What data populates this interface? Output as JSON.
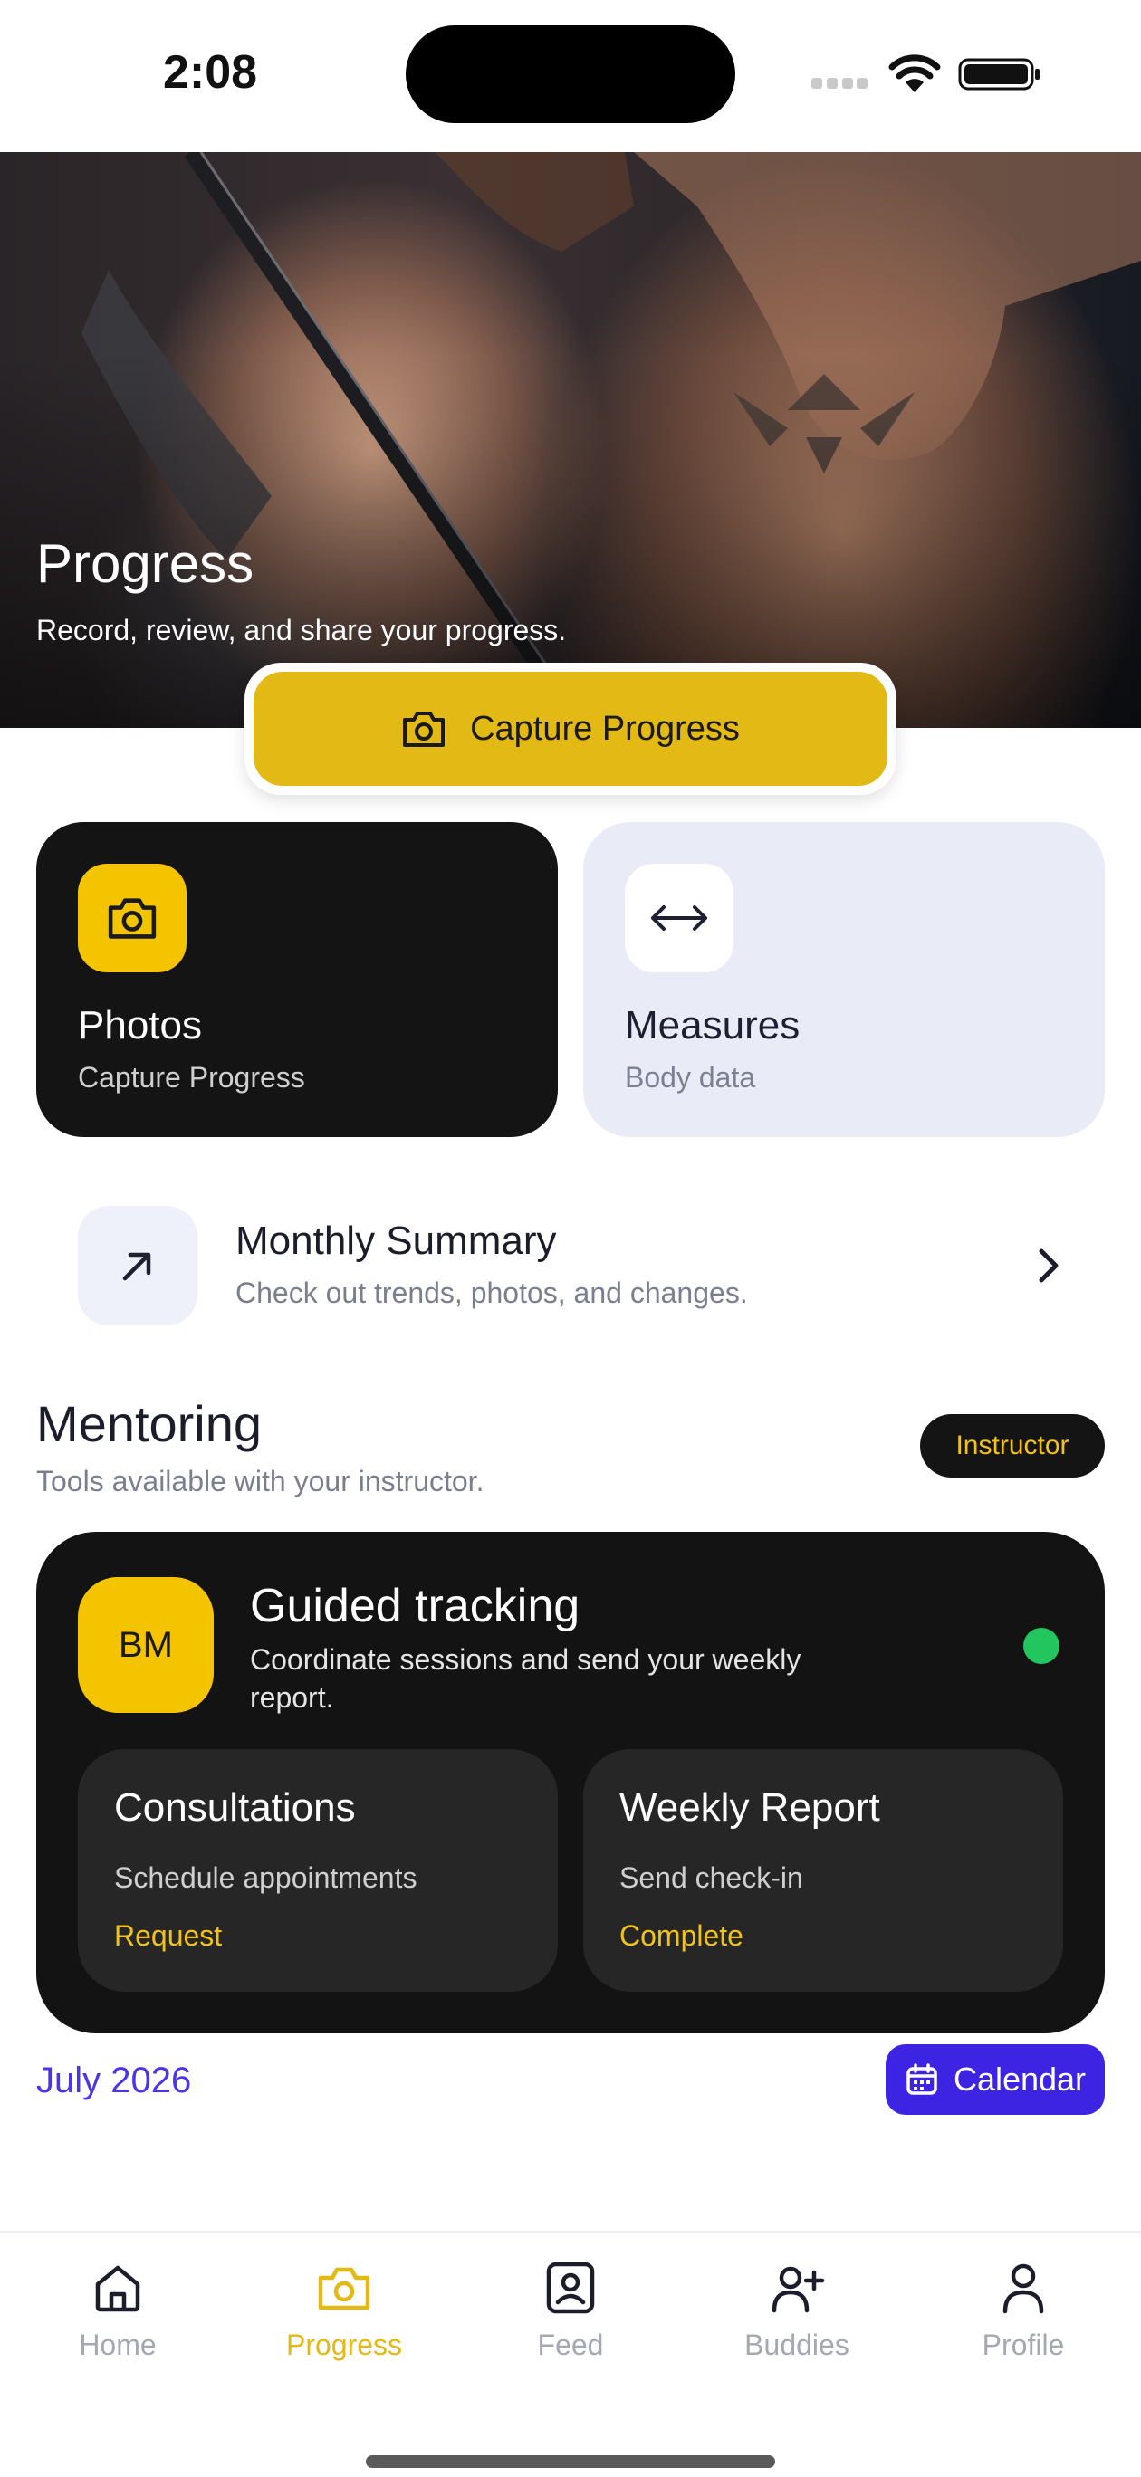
{
  "status_bar": {
    "time": "2:08"
  },
  "hero": {
    "title": "Progress",
    "subtitle": "Record, review, and share your progress.",
    "capture_button": {
      "label": "Capture Progress",
      "icon": "camera-icon"
    }
  },
  "cards": {
    "photos": {
      "title": "Photos",
      "subtitle": "Capture Progress",
      "icon": "camera-icon"
    },
    "measures": {
      "title": "Measures",
      "subtitle": "Body data",
      "icon": "arrows-horizontal-icon"
    }
  },
  "summary": {
    "title": "Monthly Summary",
    "subtitle": "Check out trends, photos, and changes.",
    "icon": "arrow-up-right-icon"
  },
  "mentoring": {
    "title": "Mentoring",
    "subtitle": "Tools available with your instructor.",
    "badge": "Instructor",
    "card": {
      "avatar_initials": "BM",
      "title": "Guided tracking",
      "subtitle": "Coordinate sessions and send your weekly report.",
      "status_color": "#22c55e",
      "consultations": {
        "title": "Consultations",
        "subtitle": "Schedule appointments",
        "action": "Request"
      },
      "weekly_report": {
        "title": "Weekly Report",
        "subtitle": "Send check-in",
        "action": "Complete"
      }
    }
  },
  "calendar": {
    "month": "July 2026",
    "button_label": "Calendar"
  },
  "tabs": [
    {
      "label": "Home",
      "icon": "home-icon",
      "active": false
    },
    {
      "label": "Progress",
      "icon": "camera-icon",
      "active": true
    },
    {
      "label": "Feed",
      "icon": "portrait-icon",
      "active": false
    },
    {
      "label": "Buddies",
      "icon": "add-user-icon",
      "active": false
    },
    {
      "label": "Profile",
      "icon": "user-icon",
      "active": false
    }
  ],
  "colors": {
    "accent": "#e3b915",
    "brand_purple": "#3c24e2",
    "dark_card": "#131313"
  }
}
